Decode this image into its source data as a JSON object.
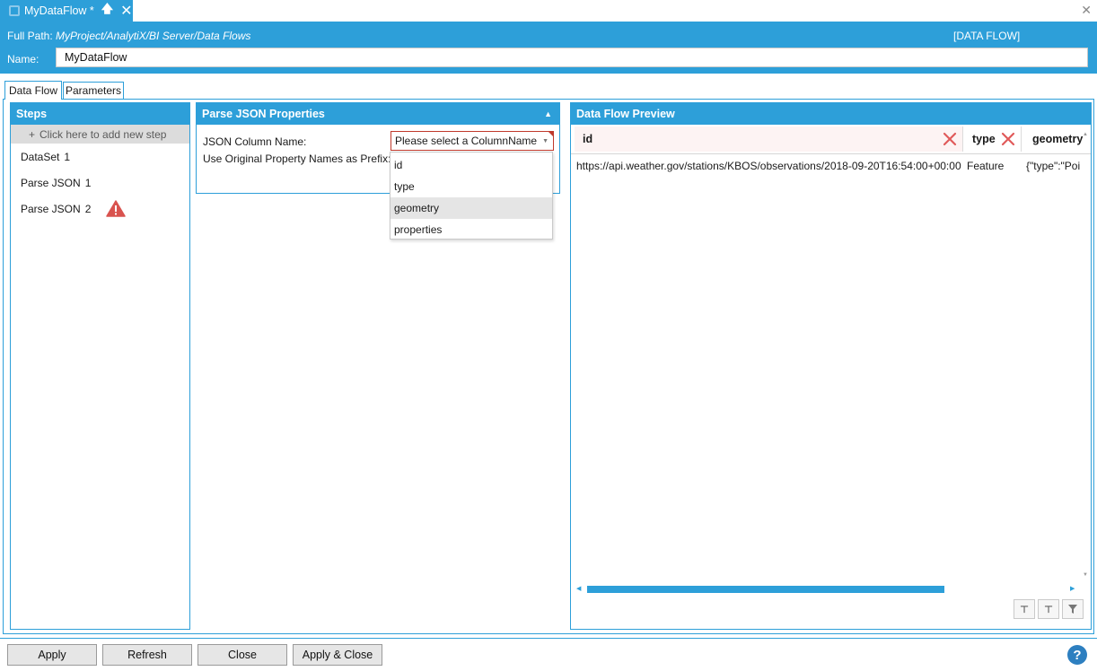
{
  "doc_tab": {
    "title": "MyDataFlow *"
  },
  "header": {
    "full_path_label": "Full Path:",
    "full_path_value": "MyProject/AnalytiX/BI Server/Data Flows",
    "type_tag": "[DATA FLOW]",
    "name_label": "Name:",
    "name_value": "MyDataFlow"
  },
  "tabs": [
    {
      "label": "Data Flow"
    },
    {
      "label": "Parameters"
    }
  ],
  "steps": {
    "title": "Steps",
    "add_step": "Click here to add new step",
    "items": [
      {
        "label": "DataSet",
        "num": "1"
      },
      {
        "label": "Parse JSON",
        "num": "1"
      },
      {
        "label": "Parse JSON",
        "num": "2",
        "warning": true
      }
    ]
  },
  "properties": {
    "title": "Parse JSON Properties",
    "column_label": "JSON Column Name:",
    "prefix_label": "Use Original Property Names as Prefix:",
    "select_placeholder": "Please select a ColumnName",
    "options": [
      "id",
      "type",
      "geometry",
      "properties"
    ],
    "highlighted_option": "geometry"
  },
  "preview": {
    "title": "Data Flow Preview",
    "columns": [
      "id",
      "type",
      "geometry"
    ],
    "rows": [
      [
        "https://api.weather.gov/stations/KBOS/observations/2018-09-20T16:54:00+00:00",
        "Feature",
        "{\"type\":\"Poi"
      ]
    ]
  },
  "footer": {
    "apply": "Apply",
    "refresh": "Refresh",
    "close": "Close",
    "apply_close": "Apply & Close",
    "help": "?"
  },
  "colors": {
    "accent": "#2d9fd9",
    "warning": "#d9534f",
    "error_border": "#c0392b"
  }
}
